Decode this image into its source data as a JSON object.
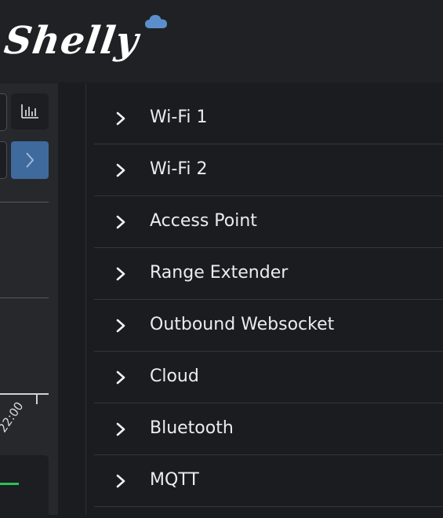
{
  "header": {
    "logo_text": "Shelly",
    "logo_icon": "cloud-icon"
  },
  "left_panel": {
    "chart_icon": "bar-chart-icon",
    "next_icon": "chevron-right-icon",
    "time_label": "22:00"
  },
  "menu": {
    "items": [
      {
        "label": "Wi-Fi 1",
        "icon": "chevron-right-icon"
      },
      {
        "label": "Wi-Fi 2",
        "icon": "chevron-right-icon"
      },
      {
        "label": "Access Point",
        "icon": "chevron-right-icon"
      },
      {
        "label": "Range Extender",
        "icon": "chevron-right-icon"
      },
      {
        "label": "Outbound Websocket",
        "icon": "chevron-right-icon"
      },
      {
        "label": "Cloud",
        "icon": "chevron-right-icon"
      },
      {
        "label": "Bluetooth",
        "icon": "chevron-right-icon"
      },
      {
        "label": "MQTT",
        "icon": "chevron-right-icon"
      }
    ]
  },
  "colors": {
    "background": "#1b1c1f",
    "header": "#1f2124",
    "accent_blue": "#3e6a9e",
    "logo_cloud": "#5b8fcc",
    "green_indicator": "#2dbf57"
  }
}
